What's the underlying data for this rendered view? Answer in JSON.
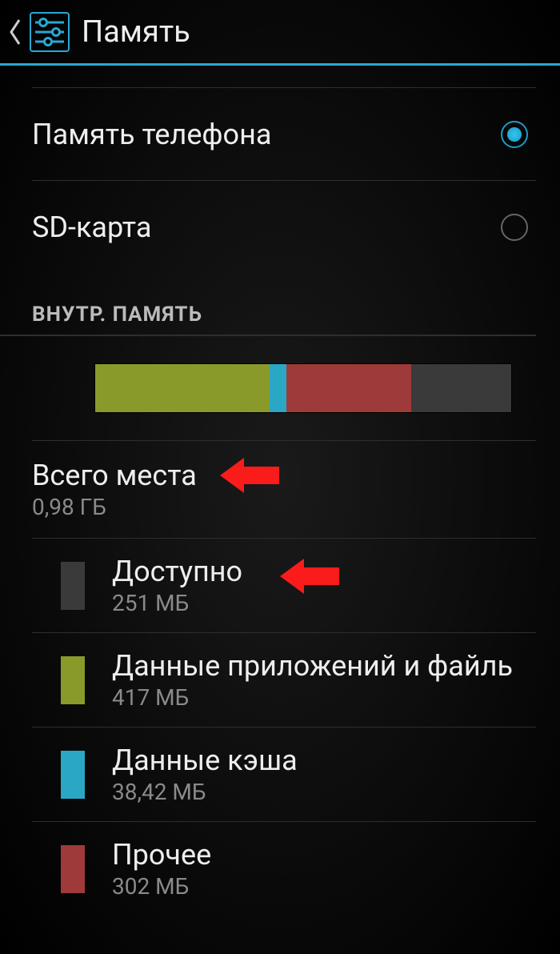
{
  "header": {
    "title": "Память"
  },
  "radios": {
    "phone_memory": {
      "label": "Память телефона",
      "checked": true
    },
    "sd_card": {
      "label": "SD-карта",
      "checked": false
    }
  },
  "section_internal": "ВНУТР. ПАМЯТЬ",
  "storage_bar": {
    "apps_pct": 42,
    "cache_pct": 4,
    "other_pct": 30,
    "free_pct": 24
  },
  "total": {
    "label": "Всего места",
    "value": "0,98 ГБ"
  },
  "items": {
    "available": {
      "label": "Доступно",
      "value": "251 МБ"
    },
    "apps": {
      "label": "Данные приложений и файль",
      "value": "417 МБ"
    },
    "cache": {
      "label": "Данные кэша",
      "value": "38,42 МБ"
    },
    "other": {
      "label": "Прочее",
      "value": "302 МБ"
    }
  },
  "colors": {
    "accent": "#2aa7d4",
    "apps": "#8a9a2a",
    "cache": "#2aa7c4",
    "other": "#9e3a3a",
    "free": "#3a3a3a",
    "annotation": "#fa1b1b"
  }
}
